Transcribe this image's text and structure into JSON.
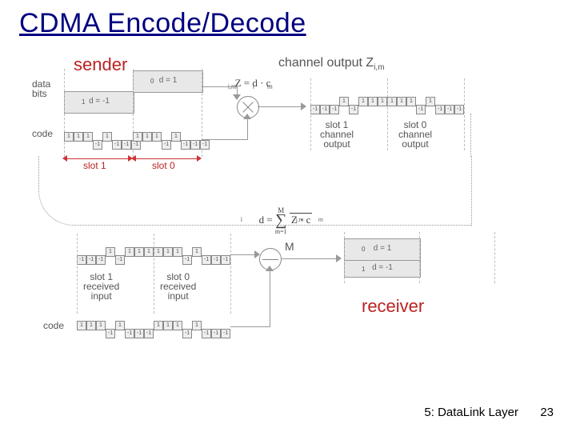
{
  "title": "CDMA Encode/Decode",
  "footer": "5: DataLink Layer",
  "page": "23",
  "sender_label": "sender",
  "receiver_label": "receiver",
  "data_bits_label": "data\nbits",
  "code_label_top": "code",
  "code_label_bot": "code",
  "channel_output_label": "channel output Z",
  "channel_output_sub": "i,m",
  "zim_formula": "Z    = d  · c",
  "zim_sub1": "i,m",
  "zim_sub2": "i",
  "zim_sub3": "m",
  "slot1_label": "slot 1",
  "slot0_label": "slot 0",
  "slot1_ch_out": "slot 1\nchannel\noutput",
  "slot0_ch_out": "slot 0\nchannel\noutput",
  "slot1_rx": "slot 1\nreceived\ninput",
  "slot0_rx": "slot 0\nreceived\ninput",
  "d0_eq": "d  = 1",
  "d0_sub": "0",
  "d1_eq": "d  = -1",
  "d1_sub": "1",
  "d_formula_top": "d  =",
  "d_formula_sub": "i",
  "sum_up": "M",
  "sum_lo": "m=1",
  "sum_body": "Z    · c",
  "sum_body_sub1": "i,m",
  "sum_body_sub2": "m",
  "M_denom": "M",
  "bit_d0": "d  = 1",
  "bit_d0_sub": "0",
  "bit_d1": "d  = -1",
  "bit_d1_sub": "1",
  "chips_code": [
    "1",
    "1",
    "1",
    "-1",
    "1",
    "-1",
    "-1",
    "-1"
  ],
  "chips_out_s1": [
    "-1",
    "-1",
    "-1",
    "1",
    "-1",
    "1",
    "1",
    "1"
  ],
  "chips_out_s0": [
    "1",
    "1",
    "1",
    "-1",
    "1",
    "-1",
    "-1",
    "-1"
  ]
}
